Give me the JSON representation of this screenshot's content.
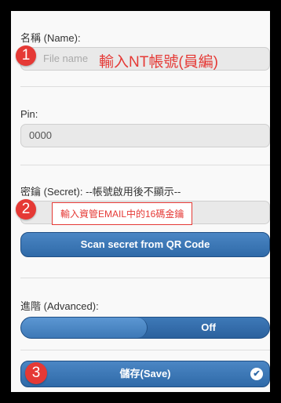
{
  "name_field": {
    "label": "名稱 (Name):",
    "placeholder": "File name",
    "badge": "1",
    "annotation": "輸入NT帳號(員編)"
  },
  "pin_field": {
    "label": "Pin:",
    "value": "0000"
  },
  "secret_field": {
    "label": "密鑰 (Secret): --帳號啟用後不顯示--",
    "badge": "2",
    "annotation": "輸入資管EMAIL中的16碼金鑰"
  },
  "scan_button": {
    "label": "Scan secret from QR Code"
  },
  "advanced": {
    "label": "進階 (Advanced):",
    "state": "Off"
  },
  "save_button": {
    "label": "儲存(Save)",
    "badge": "3"
  },
  "colors": {
    "accent": "#2f6aa8",
    "annotation": "#e53935"
  }
}
